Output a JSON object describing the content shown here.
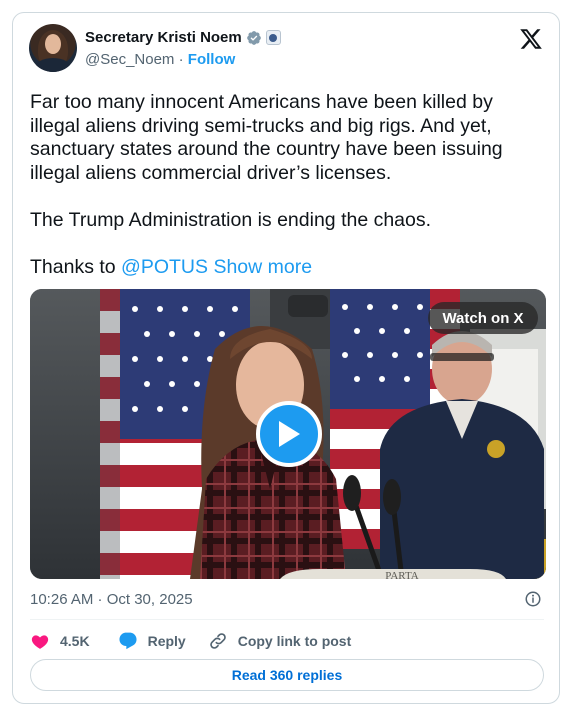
{
  "author": {
    "name": "Secretary Kristi Noem",
    "handle": "@Sec_Noem",
    "separator": "·",
    "follow_label": "Follow"
  },
  "tweet": {
    "paragraph1": "Far too many innocent Americans have been killed by illegal aliens driving semi-trucks and big rigs. And yet, sanctuary states around the country have been issuing illegal aliens commercial driver’s licenses.",
    "paragraph2": "The Trump Administration is ending the chaos.",
    "paragraph3_prefix": "Thanks to ",
    "mention": "@POTUS",
    "show_more": "Show more"
  },
  "media": {
    "watch_label": "Watch on X",
    "podium_text": "PARTA"
  },
  "meta": {
    "timestamp": "10:26 AM · Oct 30, 2025"
  },
  "actions": {
    "likes": "4.5K",
    "reply_label": "Reply",
    "copy_label": "Copy link to post",
    "read_replies": "Read 360 replies"
  },
  "colors": {
    "accent": "#1d9bf0",
    "like": "#f91880",
    "secondary_text": "#536471",
    "border": "#cfd9de"
  },
  "icons": [
    "verified-badge-icon",
    "government-seal-icon",
    "x-logo-icon",
    "play-icon",
    "info-icon",
    "heart-icon",
    "reply-icon",
    "link-icon"
  ]
}
